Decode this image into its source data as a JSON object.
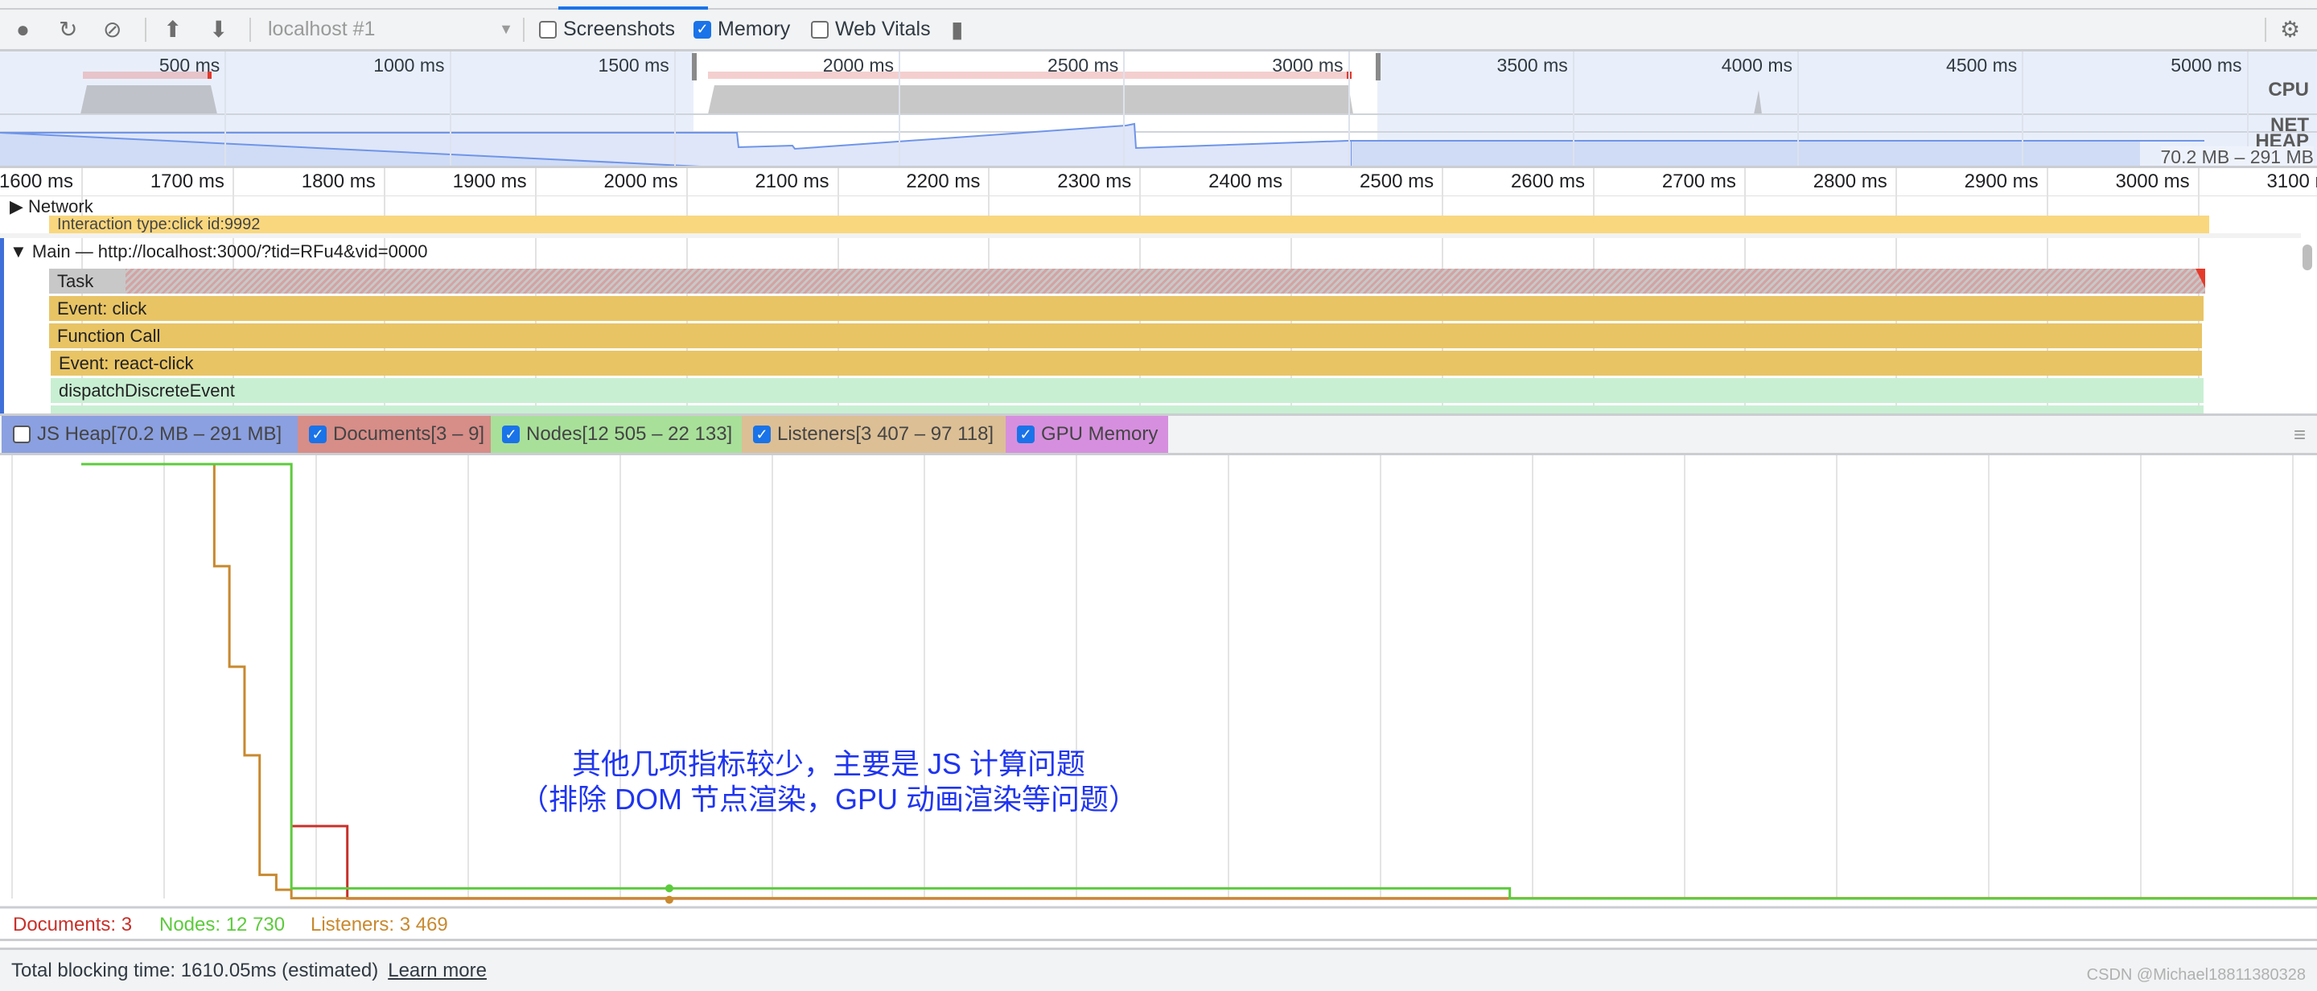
{
  "toolbar": {
    "icons": [
      "record-icon",
      "reload-icon",
      "clear-icon",
      "upload-icon",
      "download-icon",
      "trash-icon",
      "gear-icon"
    ],
    "target_select": "localhost #1",
    "checkboxes": [
      {
        "label": "Screenshots",
        "checked": false
      },
      {
        "label": "Memory",
        "checked": true
      },
      {
        "label": "Web Vitals",
        "checked": false
      }
    ]
  },
  "overview": {
    "ticks": [
      "500 ms",
      "1000 ms",
      "1500 ms",
      "2000 ms",
      "2500 ms",
      "3000 ms",
      "3500 ms",
      "4000 ms",
      "4500 ms",
      "5000 ms"
    ],
    "tick_values_ms": [
      500,
      1000,
      1500,
      2000,
      2500,
      3000,
      3500,
      4000,
      4500,
      5000
    ],
    "lanes": {
      "cpu": "CPU",
      "net": "NET",
      "heap": "HEAP"
    },
    "heap_range": "70.2 MB – 291 MB",
    "selection_ms": [
      1600,
      3100
    ]
  },
  "ruler": {
    "ticks": [
      "1600 ms",
      "1700 ms",
      "1800 ms",
      "1900 ms",
      "2000 ms",
      "2100 ms",
      "2200 ms",
      "2300 ms",
      "2400 ms",
      "2500 ms",
      "2600 ms",
      "2700 ms",
      "2800 ms",
      "2900 ms",
      "3000 ms",
      "3100 ms"
    ],
    "tick_values_ms": [
      1600,
      1700,
      1800,
      1900,
      2000,
      2100,
      2200,
      2300,
      2400,
      2500,
      2600,
      2700,
      2800,
      2900,
      3000,
      3100
    ]
  },
  "tracks": {
    "network": "Network",
    "interaction": "Interaction type:click id:9992",
    "main": "Main — http://localhost:3000/?tid=RFu4&vid=0000",
    "rows": [
      {
        "label": "Task",
        "color": "#c8c8c8"
      },
      {
        "label": "Event: click",
        "color": "#e8c465"
      },
      {
        "label": "Function Call",
        "color": "#e8c465"
      },
      {
        "label": "Event: react-click",
        "color": "#e8c465"
      },
      {
        "label": "dispatchDiscreteEvent",
        "color": "#c9efd3"
      }
    ]
  },
  "counters": [
    {
      "label": "JS Heap[70.2 MB – 291 MB]",
      "checked": false,
      "color": "#8ba0e0"
    },
    {
      "label": "Documents[3 – 9]",
      "checked": true,
      "color": "#d78d88"
    },
    {
      "label": "Nodes[12 505 – 22 133]",
      "checked": true,
      "color": "#a8e09a"
    },
    {
      "label": "Listeners[3 407 – 97 118]",
      "checked": true,
      "color": "#dcbf95"
    },
    {
      "label": "GPU Memory",
      "checked": true,
      "color": "#d68fde"
    }
  ],
  "counter_series": {
    "listeners": {
      "color": "#c8892f",
      "range": [
        3407,
        97118
      ],
      "steps": [
        [
          1600,
          97118
        ],
        [
          1688,
          75100
        ],
        [
          1698,
          53400
        ],
        [
          1708,
          34300
        ],
        [
          1718,
          8500
        ],
        [
          1729,
          5300
        ],
        [
          1739,
          3469
        ],
        [
          3200,
          3469
        ]
      ]
    },
    "nodes": {
      "color": "#5ccb3c",
      "range": [
        12505,
        22133
      ],
      "steps": [
        [
          1600,
          22133
        ],
        [
          1739,
          12730
        ],
        [
          2545,
          12505
        ],
        [
          3200,
          12505
        ]
      ]
    },
    "documents": {
      "color": "#c8302a",
      "range": [
        3,
        9
      ],
      "steps": [
        [
          1739,
          4
        ],
        [
          1776,
          3
        ],
        [
          3200,
          3
        ]
      ]
    },
    "marker_ms": 1989
  },
  "legend": [
    {
      "label": "Documents: 3",
      "color": "#c8302a"
    },
    {
      "label": "Nodes: 12 730",
      "color": "#5ccb3c"
    },
    {
      "label": "Listeners: 3 469",
      "color": "#c8892f"
    }
  ],
  "annotation": [
    "其他几项指标较少，主要是 JS 计算问题",
    "（排除 DOM 节点渲染，GPU 动画渲染等问题）"
  ],
  "status": {
    "text": "Total blocking time: 1610.05ms (estimated)",
    "link": "Learn more"
  },
  "watermark": "CSDN @Michael18811380328"
}
